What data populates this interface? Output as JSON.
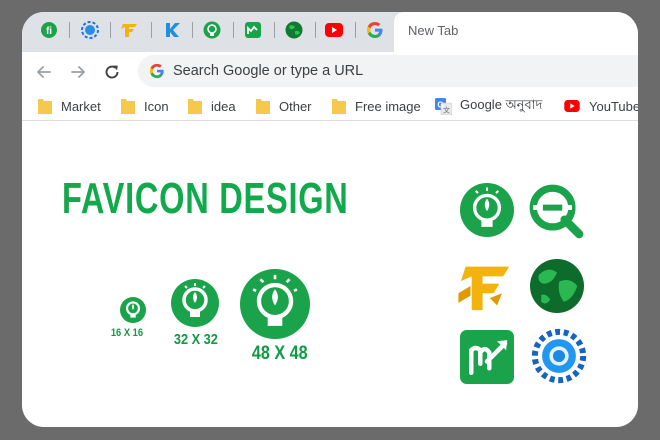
{
  "browser": {
    "active_tab": {
      "title": "New Tab"
    },
    "pinned_tabs": [
      {
        "icon": "lightbulb-g-favicon-icon"
      },
      {
        "icon": "blue-swirl-globe-icon"
      },
      {
        "icon": "gold-letter-f-icon"
      },
      {
        "icon": "blue-k-icon"
      },
      {
        "icon": "green-bulb-icon"
      },
      {
        "icon": "green-m-chart-icon"
      },
      {
        "icon": "earth-globe-icon"
      },
      {
        "icon": "youtube-icon"
      },
      {
        "icon": "google-icon"
      }
    ],
    "omnibox": {
      "placeholder": "Search Google or type a URL"
    },
    "bookmarks": [
      {
        "label": "Market",
        "icon": "folder-icon"
      },
      {
        "label": "Icon",
        "icon": "folder-icon"
      },
      {
        "label": "idea",
        "icon": "folder-icon"
      },
      {
        "label": "Other",
        "icon": "folder-icon"
      },
      {
        "label": "Free image",
        "icon": "folder-icon"
      },
      {
        "label": "Google অনুবাদ",
        "icon": "google-translate-icon"
      },
      {
        "label": "YouTube",
        "icon": "youtube-icon"
      }
    ]
  },
  "content": {
    "headline": "FAVICON DESIGN",
    "size_samples": [
      {
        "label": "16 X 16"
      },
      {
        "label": "32 X 32"
      },
      {
        "label": "48 X 48"
      }
    ],
    "gallery": [
      {
        "icon": "green-lightbulb-logo"
      },
      {
        "icon": "green-q-search-logo"
      },
      {
        "icon": "gold-f-logo"
      },
      {
        "icon": "green-globe-logo"
      },
      {
        "icon": "green-m-chart-logo"
      },
      {
        "icon": "blue-swirl-globe-logo"
      }
    ]
  },
  "colors": {
    "brand_green": "#1aa34a",
    "headline_green": "#12a94c",
    "gold": "#f2b30f",
    "youtube_red": "#ff0000",
    "chrome_tabstrip": "#dee1e6"
  }
}
